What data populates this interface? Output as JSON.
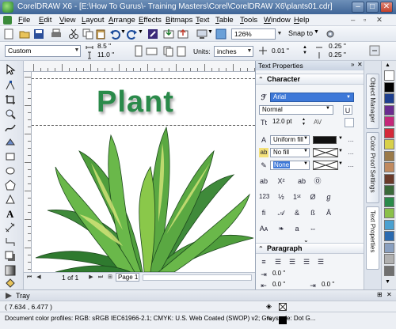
{
  "window": {
    "title": "CorelDRAW X6 - [E:\\How To Gurus\\- Training Masters\\Corel\\CorelDRAW X6\\plants01.cdr]",
    "controls": {
      "minimize": "–",
      "maximize": "□",
      "close": "✕"
    }
  },
  "menu": {
    "items": [
      {
        "label": "File"
      },
      {
        "label": "Edit"
      },
      {
        "label": "View"
      },
      {
        "label": "Layout"
      },
      {
        "label": "Arrange"
      },
      {
        "label": "Effects"
      },
      {
        "label": "Bitmaps"
      },
      {
        "label": "Text"
      },
      {
        "label": "Table"
      },
      {
        "label": "Tools"
      },
      {
        "label": "Window"
      },
      {
        "label": "Help"
      }
    ]
  },
  "toolbar_standard": {
    "zoom_value": "126%",
    "snap_to_label": "Snap to"
  },
  "property_bar": {
    "page_preset": "Custom",
    "width_value": "8.5 \"",
    "height_value": "11.0 \"",
    "units_label": "Units:",
    "units_value": "inches",
    "nudge_value": "0.01 \"",
    "dup_x_value": "0.25 \"",
    "dup_y_value": "0.25 \""
  },
  "canvas": {
    "headline": "Plant",
    "headline_color": "#2a8a4a"
  },
  "page_nav": {
    "page_counter": "1 of 1",
    "page_tab": "Page 1"
  },
  "docker": {
    "title": "Text Properties",
    "character_section": "Character",
    "font_name": "Arial",
    "font_style": "Normal",
    "font_size": "12.0 pt",
    "fill_type": "Uniform fill",
    "bg_fill": "No fill",
    "outline": "None",
    "paragraph_section": "Paragraph",
    "indent_1": "0.0 \"",
    "indent_2": "0.0 \"",
    "indent_3": "0.0 \""
  },
  "docker_tabs": [
    {
      "label": "Object Manager"
    },
    {
      "label": "Color Proof Settings"
    },
    {
      "label": "Text Properties"
    }
  ],
  "palette": {
    "colors": [
      "#ffffff",
      "#000000",
      "#1e3f8f",
      "#6a2b8f",
      "#c4287a",
      "#d42a3a",
      "#d8d04a",
      "#9a7a4a",
      "#c08a60",
      "#6a3a2a",
      "#3a6a3a",
      "#2a8a4a",
      "#8ac04a",
      "#4aa0d0",
      "#2a6ab0",
      "#8aa0c0",
      "#b0b0b0",
      "#707070"
    ]
  },
  "tray": {
    "label": "Tray"
  },
  "status": {
    "coordinates": "( 7.634 , 6.477 )",
    "color_profiles": "Document color profiles: RGB: sRGB IEC61966-2.1; CMYK: U.S. Web Coated (SWOP) v2; Grayscale: Dot G..."
  }
}
